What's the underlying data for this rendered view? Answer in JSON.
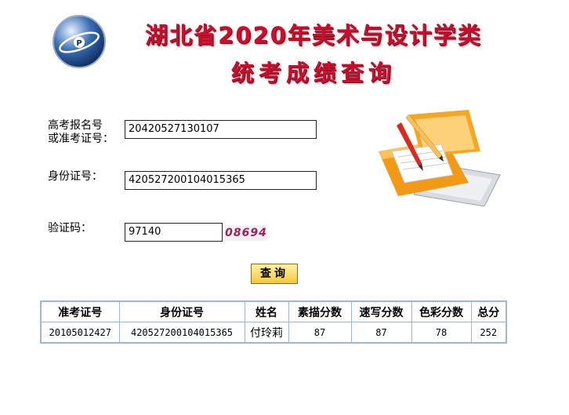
{
  "header": {
    "title_line1": "湖北省2020年美术与设计学类",
    "title_line2": "统考成绩查询",
    "logo_icon": "exam-authority-globe-logo"
  },
  "form": {
    "exam_number_label_line1": "高考报名号",
    "exam_number_label_line2": "或准考证号：",
    "exam_number_value": "20420527130107",
    "id_label": "身份证号：",
    "id_value": "420527200104015365",
    "captcha_label": "验证码：",
    "captcha_value": "97140",
    "captcha_image_text": "08694",
    "submit_label": "查询"
  },
  "illustration_icon": "folder-with-pencil-and-documents-icon",
  "results": {
    "headers": [
      "准考证号",
      "身份证号",
      "姓名",
      "素描分数",
      "速写分数",
      "色彩分数",
      "总分"
    ],
    "rows": [
      [
        "20105012427",
        "420527200104015365",
        "付玲莉",
        "87",
        "87",
        "78",
        "252"
      ]
    ]
  },
  "colors": {
    "title": "#c8102e",
    "table_border": "#9fb6d6",
    "button": "#f4c73a"
  }
}
